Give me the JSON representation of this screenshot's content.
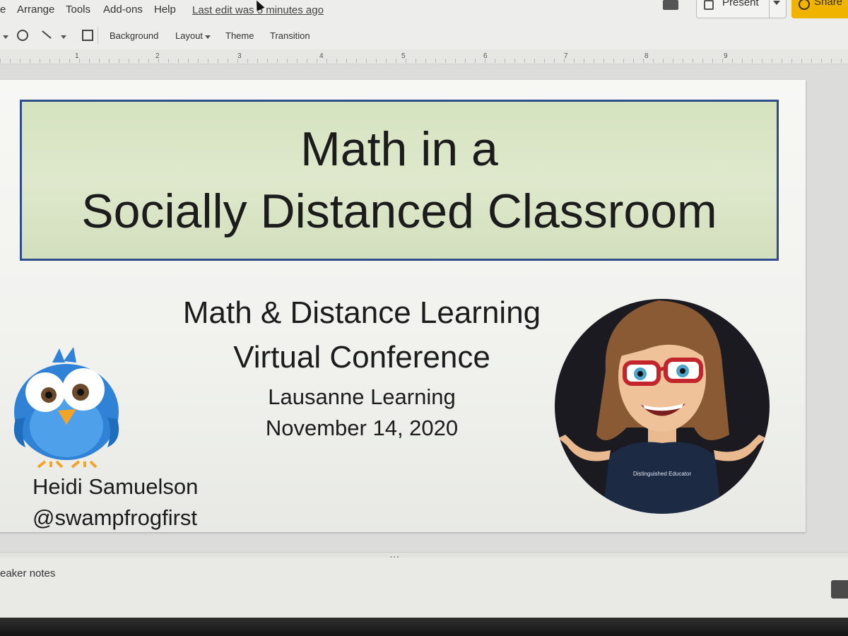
{
  "menu": {
    "items": [
      "e",
      "Arrange",
      "Tools",
      "Add-ons",
      "Help"
    ],
    "last_edit": "Last edit was 5 minutes ago"
  },
  "header": {
    "present_label": "Present",
    "share_label": "Share"
  },
  "toolbar": {
    "background": "Background",
    "layout": "Layout",
    "theme": "Theme",
    "transition": "Transition"
  },
  "ruler": {
    "numbers": [
      "1",
      "2",
      "3",
      "4",
      "5",
      "6",
      "7",
      "8",
      "9"
    ]
  },
  "slide": {
    "title_line1": "Math in a",
    "title_line2": "Socially Distanced Classroom",
    "subtitle_line1": "Math & Distance Learning",
    "subtitle_line2": "Virtual Conference",
    "organizer": "Lausanne Learning",
    "date": "November 14, 2020",
    "author_name": "Heidi Samuelson",
    "author_handle": "@swampfrogfirst",
    "avatar_shirt_text": "Distinguished Educator"
  },
  "notes": {
    "label": "eaker notes"
  },
  "colors": {
    "title_fill": "#d8e4c4",
    "title_border": "#2f4d8b",
    "share_button": "#f0b400",
    "bird_blue": "#2f82d6",
    "avatar_bg": "#1a1a20"
  },
  "icons": [
    "present-icon",
    "share-icon",
    "comment-icon",
    "shape-icon",
    "line-icon",
    "add-comment-icon"
  ]
}
